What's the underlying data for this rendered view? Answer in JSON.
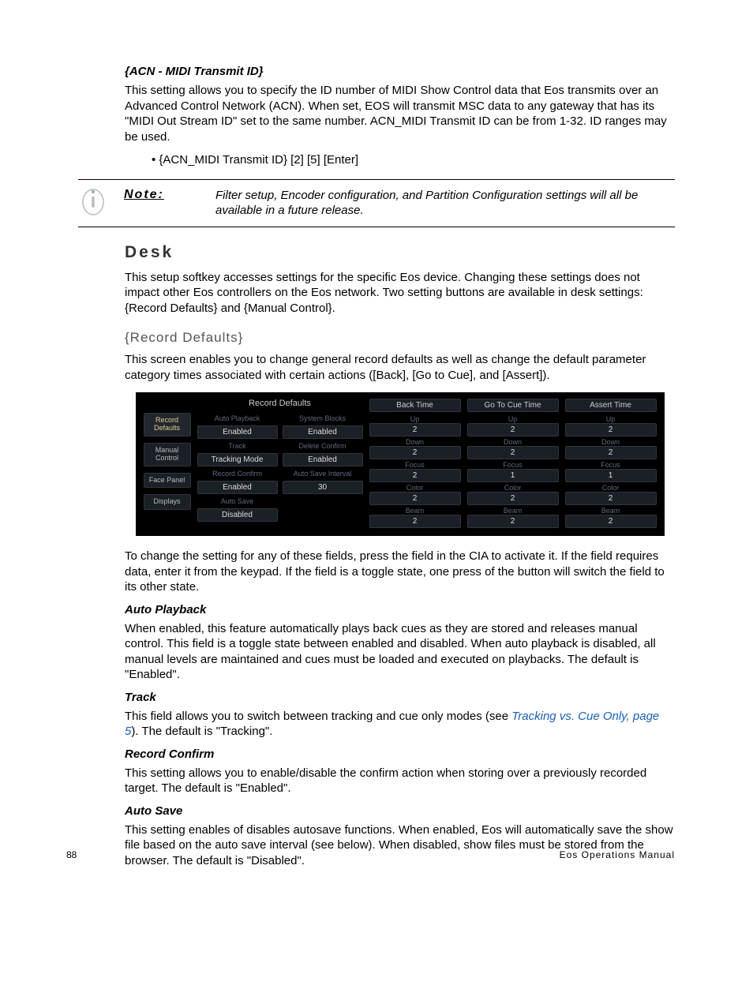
{
  "section1": {
    "heading": "{ACN - MIDI Transmit ID}",
    "para": "This setting allows you to specify the ID number of MIDI Show Control data that Eos transmits over an Advanced Control Network (ACN). When set, EOS will transmit MSC data to any gateway that has its \"MIDI Out Stream ID\" set to the same number. ACN_MIDI Transmit ID can be from 1-32. ID ranges may be used.",
    "bullet": "{ACN_MIDI Transmit ID} [2] [5] [Enter]"
  },
  "note": {
    "label": "Note:",
    "text": "Filter setup, Encoder configuration, and Partition Configuration settings will all be available in a future release."
  },
  "desk": {
    "heading": "Desk",
    "para": "This setup softkey accesses settings for the specific Eos device. Changing these settings does not impact other Eos controllers on the Eos network. Two setting buttons are available in desk settings: {Record Defaults} and {Manual Control}."
  },
  "recdef": {
    "heading": "{Record Defaults}",
    "para": "This screen enables you to change general record defaults as well as change the default parameter category times associated with certain actions ([Back], [Go to Cue], and [Assert])."
  },
  "panel": {
    "title": "Record Defaults",
    "tabs": [
      "Record Defaults",
      "Manual Control",
      "Face Panel",
      "Displays"
    ],
    "settings": [
      {
        "l": "Auto Playback",
        "v": "Enabled",
        "l2": "System Blocks",
        "v2": "Enabled"
      },
      {
        "l": "Track",
        "v": "Tracking Mode",
        "l2": "Delete Confirm",
        "v2": "Enabled"
      },
      {
        "l": "Record Confirm",
        "v": "Enabled",
        "l2": "Auto Save Interval",
        "v2": "30"
      },
      {
        "l": "Auto Save",
        "v": "Disabled",
        "l2": "",
        "v2": ""
      }
    ],
    "timecols": [
      {
        "head": "Back Time",
        "rows": [
          [
            "Up",
            "2"
          ],
          [
            "Down",
            "2"
          ],
          [
            "Focus",
            "2"
          ],
          [
            "Color",
            "2"
          ],
          [
            "Beam",
            "2"
          ]
        ]
      },
      {
        "head": "Go To Cue Time",
        "rows": [
          [
            "Up",
            "2"
          ],
          [
            "Down",
            "2"
          ],
          [
            "Focus",
            "1"
          ],
          [
            "Color",
            "2"
          ],
          [
            "Beam",
            "2"
          ]
        ]
      },
      {
        "head": "Assert Time",
        "rows": [
          [
            "Up",
            "2"
          ],
          [
            "Down",
            "2"
          ],
          [
            "Focus",
            "1"
          ],
          [
            "Color",
            "2"
          ],
          [
            "Beam",
            "2"
          ]
        ]
      }
    ]
  },
  "afterpanel": "To change the setting for any of these fields, press the field in the CIA to activate it. If the field requires data, enter it from the keypad. If the field is a toggle state, one press of the button will switch the field to its other state.",
  "autoplayback": {
    "heading": "Auto Playback",
    "para": "When enabled, this feature automatically plays back cues as they are stored and releases manual control. This field is a toggle state between enabled and disabled. When auto playback is disabled, all manual levels are maintained and cues must be loaded and executed on playbacks. The default is \"Enabled\"."
  },
  "track": {
    "heading": "Track",
    "para1": "This field allows you to switch between tracking and cue only modes (see ",
    "link": "Tracking vs. Cue Only, page 5",
    "para2": "). The default is \"Tracking\"."
  },
  "recordconfirm": {
    "heading": "Record Confirm",
    "para": "This setting allows you to enable/disable the confirm action when storing over a previously recorded target. The default is \"Enabled\"."
  },
  "autosave": {
    "heading": "Auto Save",
    "para": "This setting enables of disables autosave functions. When enabled, Eos will automatically save the show file based on the auto save interval (see below). When disabled, show files must be stored from the browser. The default is \"Disabled\"."
  },
  "footer": {
    "page": "88",
    "title": "Eos Operations Manual"
  }
}
